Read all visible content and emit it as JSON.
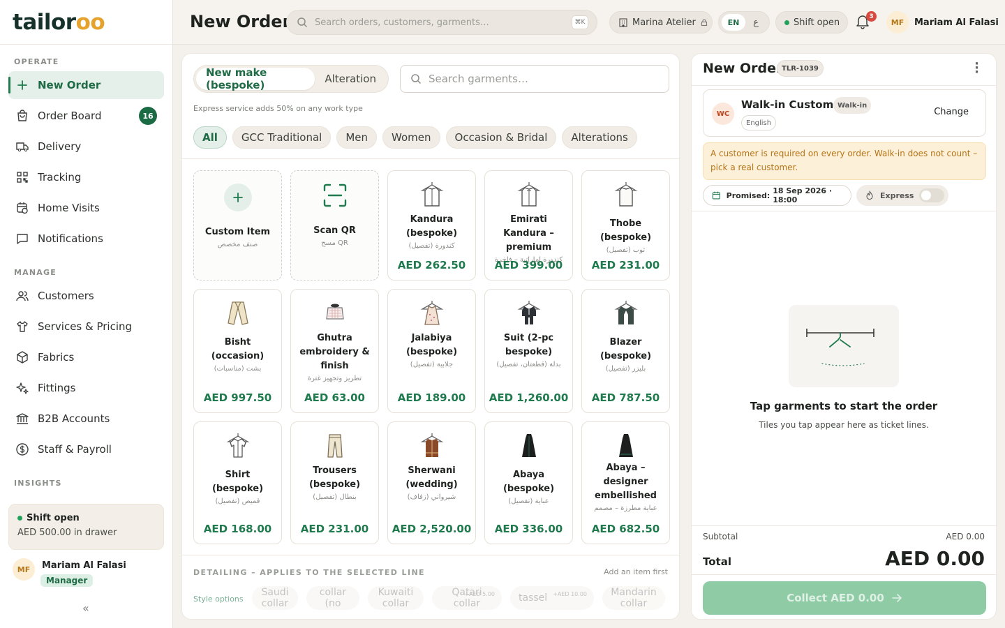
{
  "brand": {
    "logo_a": "tailor",
    "logo_b": "oo"
  },
  "sidebar": {
    "sections": {
      "operate": "OPERATE",
      "manage": "MANAGE",
      "insights": "INSIGHTS"
    },
    "items": [
      {
        "label": "New Order",
        "icon": "plus-icon"
      },
      {
        "label": "Order Board",
        "icon": "bag-icon",
        "badge": "16"
      },
      {
        "label": "Delivery",
        "icon": "truck-icon"
      },
      {
        "label": "Tracking",
        "icon": "qr-icon"
      },
      {
        "label": "Home Visits",
        "icon": "calendar-icon"
      },
      {
        "label": "Notifications",
        "icon": "message-icon"
      },
      {
        "label": "Customers",
        "icon": "users-icon"
      },
      {
        "label": "Services & Pricing",
        "icon": "shirt-icon"
      },
      {
        "label": "Fabrics",
        "icon": "cube-icon"
      },
      {
        "label": "Fittings",
        "icon": "sparkle-icon"
      },
      {
        "label": "B2B Accounts",
        "icon": "bank-icon"
      },
      {
        "label": "Staff & Payroll",
        "icon": "dollar-icon"
      }
    ],
    "shift": {
      "status": "Shift open",
      "drawer": "AED 500.00 in drawer"
    },
    "user": {
      "initials": "MF",
      "name": "Mariam Al Falasi",
      "role": "Manager"
    },
    "collapse": "«"
  },
  "header": {
    "title": "New Order",
    "search_placeholder": "Search orders, customers, garments…",
    "shortcut": "⌘K",
    "store": "Marina Atelier",
    "lang_en": "EN",
    "lang_ar": "ع",
    "shift": "Shift open",
    "notifications": "3",
    "user_initials": "MF",
    "user_name": "Mariam Al Falasi"
  },
  "catalog": {
    "modes": [
      "New make (bespoke)",
      "Alteration"
    ],
    "search_placeholder": "Search garments…",
    "hint": "Express service adds 50% on any work type",
    "categories": [
      "All",
      "GCC Traditional",
      "Men",
      "Women",
      "Occasion & Bridal",
      "Alterations"
    ],
    "tiles": [
      {
        "name": "Custom Item",
        "ar": "صنف مخصص",
        "price": ""
      },
      {
        "name": "Scan QR",
        "ar": "مسح QR",
        "price": ""
      },
      {
        "name": "Kandura (bespoke)",
        "ar": "كندورة (تفصيل)",
        "price": "AED 262.50"
      },
      {
        "name": "Emirati Kandura – premium",
        "ar": "كندورة إماراتية – فاخرة",
        "price": "AED 399.00"
      },
      {
        "name": "Thobe (bespoke)",
        "ar": "ثوب (تفصيل)",
        "price": "AED 231.00"
      },
      {
        "name": "Bisht (occasion)",
        "ar": "بشت (مناسبات)",
        "price": "AED 997.50"
      },
      {
        "name": "Ghutra embroidery & finish",
        "ar": "تطريز وتجهيز غترة",
        "price": "AED 63.00"
      },
      {
        "name": "Jalabiya (bespoke)",
        "ar": "جلابية (تفصيل)",
        "price": "AED 189.00"
      },
      {
        "name": "Suit (2-pc bespoke)",
        "ar": "بدلة (قطعتان، تفصيل)",
        "price": "AED 1,260.00"
      },
      {
        "name": "Blazer (bespoke)",
        "ar": "بليزر (تفصيل)",
        "price": "AED 787.50"
      },
      {
        "name": "Shirt (bespoke)",
        "ar": "قميص (تفصيل)",
        "price": "AED 168.00"
      },
      {
        "name": "Trousers (bespoke)",
        "ar": "بنطال (تفصيل)",
        "price": "AED 231.00"
      },
      {
        "name": "Sherwani (wedding)",
        "ar": "شيرواني (زفاف)",
        "price": "AED 2,520.00"
      },
      {
        "name": "Abaya (bespoke)",
        "ar": "عباية (تفصيل)",
        "price": "AED 336.00"
      },
      {
        "name": "Abaya – designer embellished",
        "ar": "عباية مطرزة – مصمم",
        "price": "AED 682.50"
      }
    ],
    "detailing": {
      "label": "DETAILING – APPLIES TO THE SELECTED LINE",
      "hint": "Add an item first",
      "style_label": "Style options",
      "options": [
        {
          "label": "Saudi collar",
          "add": ""
        },
        {
          "label": "collar (no",
          "add": ""
        },
        {
          "label": "Kuwaiti collar",
          "add": ""
        },
        {
          "label": "Qatari collar",
          "add": "+AED 5.00"
        },
        {
          "label": "tassel",
          "add": "+AED 10.00"
        },
        {
          "label": "Mandarin collar",
          "add": ""
        }
      ]
    }
  },
  "order": {
    "title": "New Order",
    "ticket": "TLR-1039",
    "customer": {
      "initials": "WC",
      "name": "Walk-in Customer",
      "tag": "Walk-in",
      "lang": "English",
      "change": "Change"
    },
    "warning": "A customer is required on every order. Walk-in does not count – pick a real customer.",
    "promised_label": "Promised:",
    "promised_value": "18 Sep 2026 · 18:00",
    "express": "Express",
    "express_on": false,
    "empty_title": "Tap garments to start the order",
    "empty_sub": "Tiles you tap appear here as ticket lines.",
    "subtotal_label": "Subtotal",
    "subtotal": "AED 0.00",
    "total_label": "Total",
    "total": "AED 0.00",
    "collect": "Collect AED 0.00"
  },
  "colors": {
    "accent": "#1f7a4d",
    "warning_bg": "#fdf0d9",
    "warning_text": "#b57415",
    "logo_accent": "#e5a32d"
  }
}
